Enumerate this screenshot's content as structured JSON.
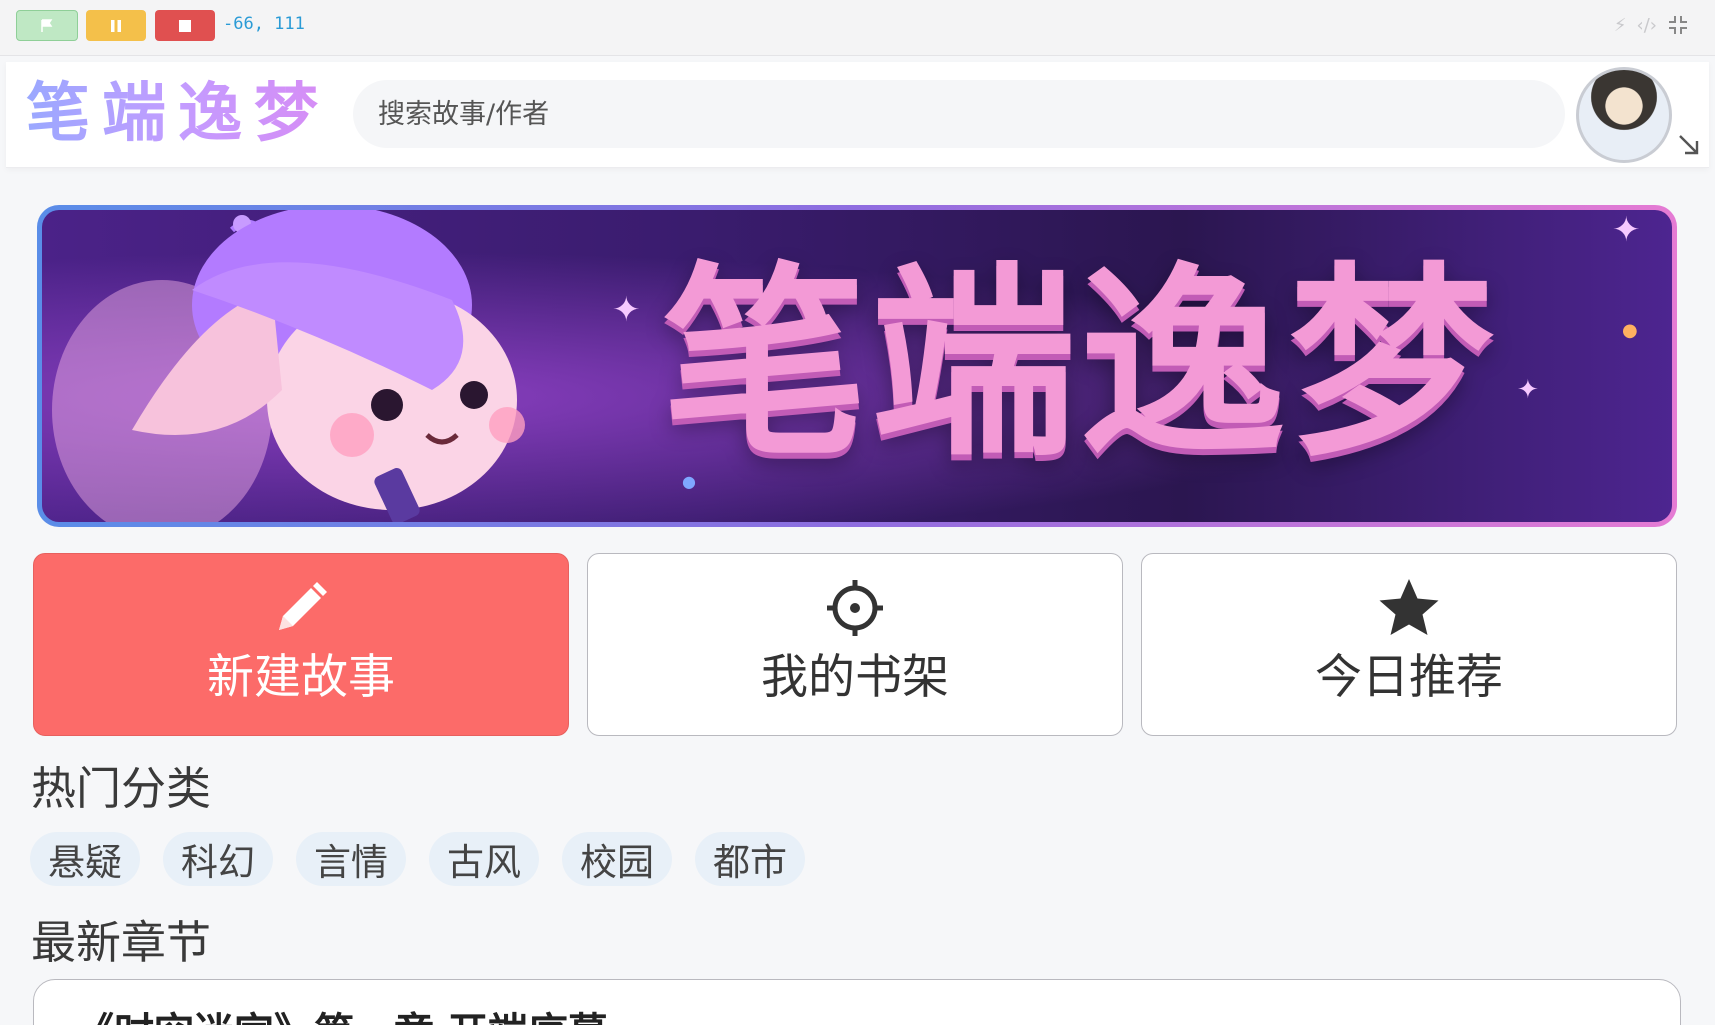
{
  "controls": {
    "coords": "-66, 111",
    "icons": [
      "flag-icon",
      "pause-icon",
      "stop-icon",
      "bolt-icon",
      "code-icon",
      "collapse-icon"
    ],
    "colors": {
      "flag": "#bfe8c4",
      "pause": "#f4c04a",
      "stop": "#e05050",
      "coords": "#2a9bd6"
    }
  },
  "header": {
    "logo": "笔端逸梦",
    "search_placeholder": "搜索故事/作者"
  },
  "banner": {
    "title": "笔端逸梦"
  },
  "actions": [
    {
      "label": "新建故事",
      "icon": "pencil-icon"
    },
    {
      "label": "我的书架",
      "icon": "target-icon"
    },
    {
      "label": "今日推荐",
      "icon": "star-icon"
    }
  ],
  "hot": {
    "title": "热门分类",
    "tags": [
      "悬疑",
      "科幻",
      "言情",
      "古风",
      "校园",
      "都市"
    ]
  },
  "latest": {
    "title": "最新章节",
    "first_item": "《时空迷宫》第一章 开端序幕"
  },
  "colors": {
    "accent": "#fc6b69",
    "tag_bg": "#e8f0f8",
    "banner_title": "#f39ad6"
  }
}
